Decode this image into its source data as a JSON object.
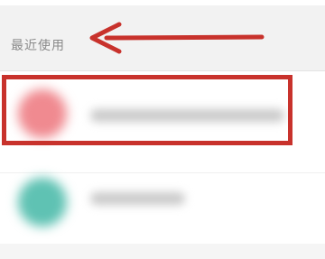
{
  "section": {
    "title": "最近使用"
  },
  "items": [
    {
      "name": "",
      "avatar_color": "#f08a90"
    },
    {
      "name": "",
      "avatar_color": "#5fc2b3"
    }
  ],
  "annotation": {
    "color": "#c8322c"
  }
}
